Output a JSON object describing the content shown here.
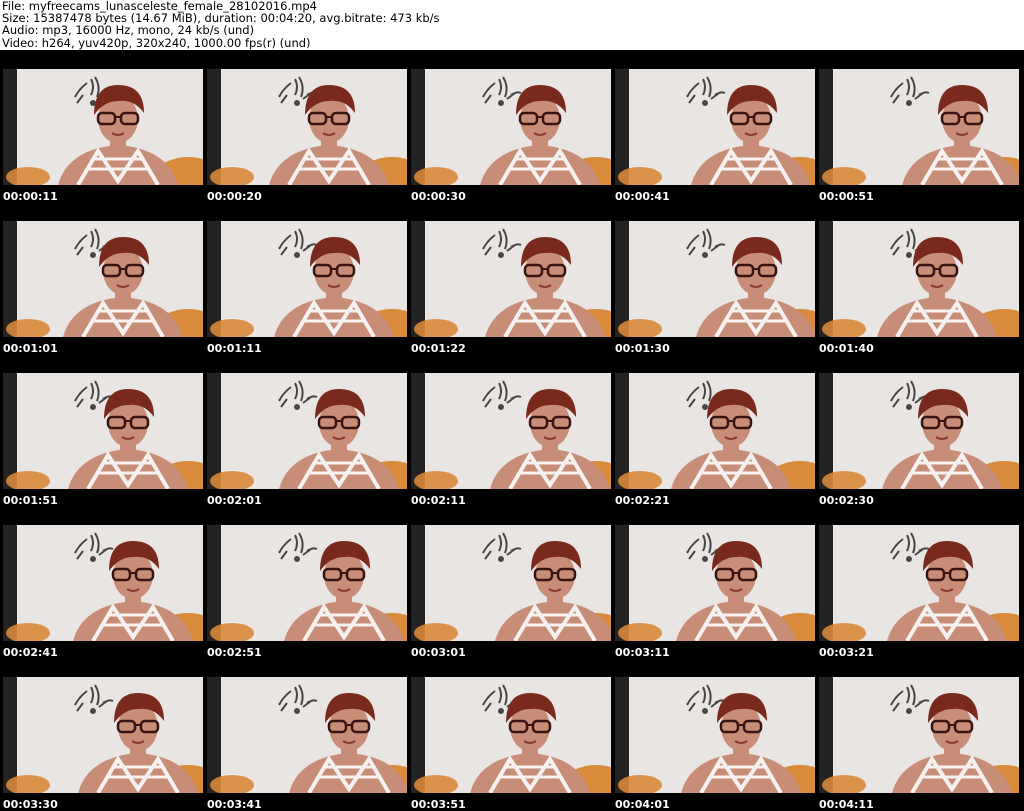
{
  "header": {
    "file": "File: myfreecams_lunasceleste_female_28102016.mp4",
    "size": "Size: 15387478 bytes (14.67 MiB), duration: 00:04:20, avg.bitrate: 473 kb/s",
    "audio": "Audio: mp3, 16000 Hz, mono, 24 kb/s (und)",
    "video": "Video: h264, yuv420p, 320x240, 1000.00 fps(r) (und)"
  },
  "thumbnails": [
    {
      "timestamp": "00:00:11"
    },
    {
      "timestamp": "00:00:20"
    },
    {
      "timestamp": "00:00:30"
    },
    {
      "timestamp": "00:00:41"
    },
    {
      "timestamp": "00:00:51"
    },
    {
      "timestamp": "00:01:01"
    },
    {
      "timestamp": "00:01:11"
    },
    {
      "timestamp": "00:01:22"
    },
    {
      "timestamp": "00:01:30"
    },
    {
      "timestamp": "00:01:40"
    },
    {
      "timestamp": "00:01:51"
    },
    {
      "timestamp": "00:02:01"
    },
    {
      "timestamp": "00:02:11"
    },
    {
      "timestamp": "00:02:21"
    },
    {
      "timestamp": "00:02:30"
    },
    {
      "timestamp": "00:02:41"
    },
    {
      "timestamp": "00:02:51"
    },
    {
      "timestamp": "00:03:01"
    },
    {
      "timestamp": "00:03:11"
    },
    {
      "timestamp": "00:03:21"
    },
    {
      "timestamp": "00:03:30"
    },
    {
      "timestamp": "00:03:41"
    },
    {
      "timestamp": "00:03:51"
    },
    {
      "timestamp": "00:04:01"
    },
    {
      "timestamp": "00:04:11"
    }
  ],
  "colors": {
    "wall": "#e9e5e3",
    "skin": "#c88d76",
    "hair": "#7a2a1c",
    "glasses": "#3a1410",
    "top": "#f4f1ef",
    "cushion": "#d98a3a",
    "shadow": "#232323",
    "wall_art": "#2b2b2b"
  }
}
